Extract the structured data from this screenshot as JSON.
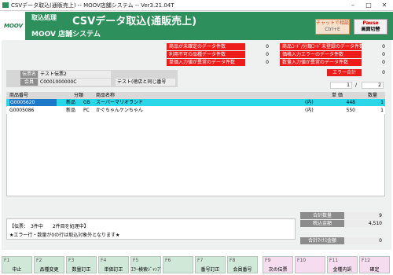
{
  "window": {
    "title": "CSVデータ取込(通販売上) -- MOOV店舗システム -- Ver3.21.04T",
    "minimize": "–",
    "maximize": "□",
    "close": "✕"
  },
  "header": {
    "logo": "MOOV",
    "subtitle": "取込処理",
    "title": "CSVデータ取込(通販売上)",
    "system": "MOOV 店舗システム",
    "chat_line1": "チャットで相談",
    "chat_line2": "Ctrl+E",
    "pause_line1": "Pause",
    "pause_line2": "画面切替",
    "color": "#2d8f5b"
  },
  "errors_left": [
    {
      "label": "商品が未確定のデータ件数",
      "value": "0"
    },
    {
      "label": "利用不可の品種データ件数",
      "value": "0"
    },
    {
      "label": "単価入力値が異常のデータ件数",
      "value": "0"
    }
  ],
  "errors_right": [
    {
      "label": "商品ｺｰﾄﾞ/分類ｺｰﾄﾞ未登録のデータ件数",
      "value": "0"
    },
    {
      "label": "価格入力エラーのデータ件数",
      "value": "0"
    },
    {
      "label": "数量入力値が異常のデータ件数",
      "value": "0"
    }
  ],
  "error_total": {
    "label": "エラー合計",
    "value": "0"
  },
  "pager": {
    "current": "1",
    "sep": "/",
    "total": "2"
  },
  "info": {
    "slip_label": "伝票名",
    "slip_value": "テスト伝票2",
    "member_label": "会員",
    "member_value": "C0001000000C",
    "member_note": "テスト(徳店と同じ番号"
  },
  "table": {
    "headers": [
      "商品番号",
      "分類",
      "商品名称",
      "単 価",
      "数量"
    ],
    "rows": [
      {
        "code": "G0005620",
        "type": "新品",
        "cat": "GB",
        "name": "スーパーマリオランド",
        "tax": "(内)",
        "price": "448",
        "qty": "1",
        "selected": true
      },
      {
        "code": "G0005086",
        "type": "新品",
        "cat": "PC",
        "name": "かぐちゃんケンちゃん",
        "tax": "(内)",
        "price": "550",
        "qty": "1",
        "selected": false
      }
    ]
  },
  "status": {
    "line1": "【伝票：　3件中　　2件目を処理中】",
    "line2": "★エラー行・数量が0の行は取込対象外となります★"
  },
  "summary": {
    "total_qty_label": "合計数量",
    "total_qty": "9",
    "tax_total_label": "税込金額",
    "tax_total": "4,510",
    "minus_label": "合計ﾏｲﾅｽ金額",
    "minus_value": "0"
  },
  "fkeys": [
    {
      "num": "F1",
      "label": "中止",
      "color": "#cfe8d8"
    },
    {
      "num": "F2",
      "label": "品種変更",
      "color": "#cfe8d8"
    },
    {
      "num": "F3",
      "label": "数量訂正",
      "color": "#cfe8d8"
    },
    {
      "num": "F4",
      "label": "単価訂正",
      "color": "#cfe8d8"
    },
    {
      "num": "F5",
      "label": "ｴﾗｰ検索ｼﾞｬﾝﾌﾟ",
      "color": "#cfe8d8"
    },
    {
      "num": "F6",
      "label": "",
      "color": "#cfe8d8"
    },
    {
      "num": "F7",
      "label": "番号訂正",
      "color": "#cfe8d8"
    },
    {
      "num": "F8",
      "label": "会員番号",
      "color": "#cfe8d8"
    },
    {
      "num": "F9",
      "label": "次の伝票",
      "color": "#f6dcef"
    },
    {
      "num": "F10",
      "label": "",
      "color": "#f6dcef"
    },
    {
      "num": "F11",
      "label": "金種内訳",
      "color": "#f6dcef"
    },
    {
      "num": "F12",
      "label": "確定",
      "color": "#f6dcef"
    }
  ]
}
